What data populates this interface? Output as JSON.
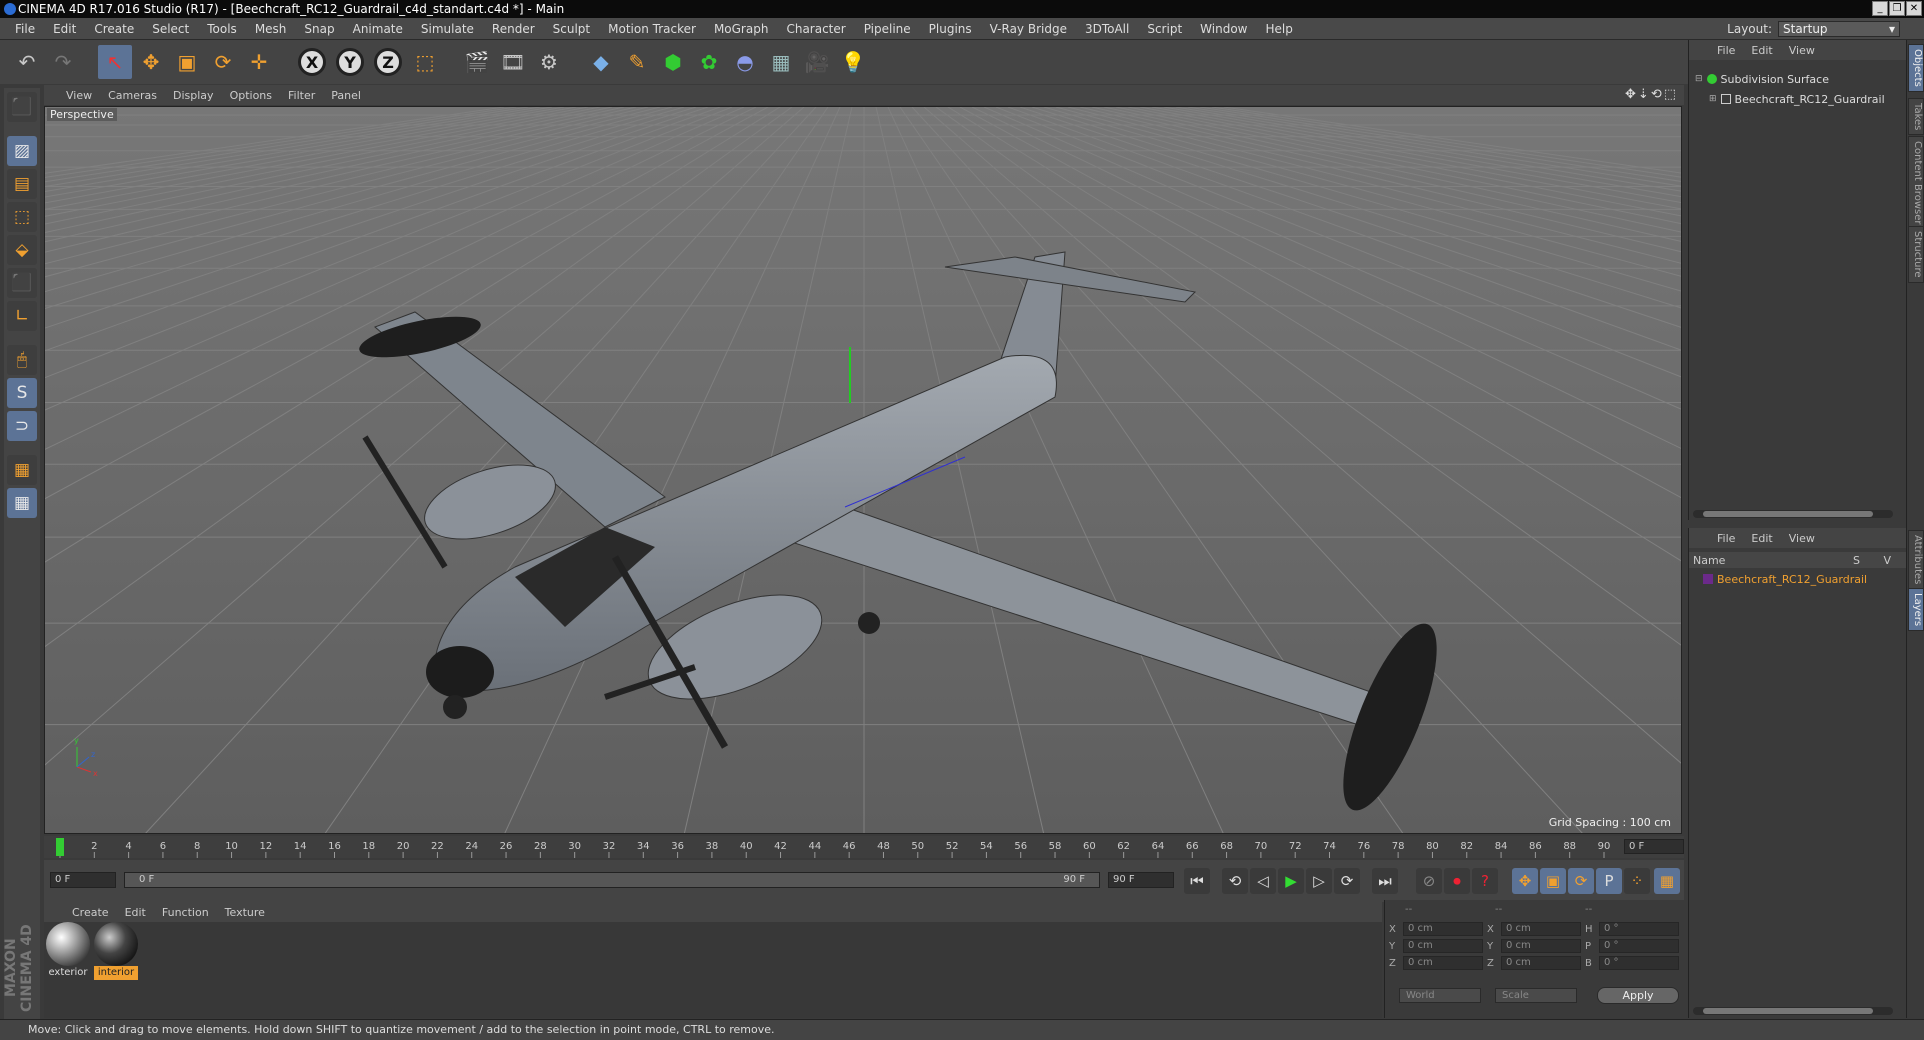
{
  "window": {
    "title": "CINEMA 4D R17.016 Studio (R17) - [Beechcraft_RC12_Guardrail_c4d_standart.c4d *] - Main",
    "buttons": [
      "_",
      "❐",
      "✕"
    ]
  },
  "menu": [
    "File",
    "Edit",
    "Create",
    "Select",
    "Tools",
    "Mesh",
    "Snap",
    "Animate",
    "Simulate",
    "Render",
    "Sculpt",
    "Motion Tracker",
    "MoGraph",
    "Character",
    "Pipeline",
    "Plugins",
    "V-Ray Bridge",
    "3DToAll",
    "Script",
    "Window",
    "Help"
  ],
  "layout": {
    "label": "Layout:",
    "value": "Startup"
  },
  "toolbar": {
    "undo": "↶",
    "redo": "↷",
    "select": "↖",
    "move": "✥",
    "scale": "▣",
    "rotate": "⟳",
    "last": "✛",
    "x": "X",
    "y": "Y",
    "z": "Z",
    "coord": "⬚",
    "render_view": "🎬",
    "render_pv": "🎞",
    "render_settings": "⚙",
    "cube": "◆",
    "pen": "✎",
    "nurbs": "⬢",
    "array": "✿",
    "deformer": "◓",
    "floor": "▦",
    "camera": "🎥",
    "light": "💡"
  },
  "lefttools": [
    "⬛",
    "▨",
    "▤",
    "⬚",
    "⬙",
    "⬛",
    "∟",
    "🖱",
    "S",
    "⊃",
    "▦",
    "▦"
  ],
  "viewport": {
    "menu": [
      "View",
      "Cameras",
      "Display",
      "Options",
      "Filter",
      "Panel"
    ],
    "nav_icons": "✥⇣⟲⬚",
    "label": "Perspective",
    "grid_spacing": "Grid Spacing : 100 cm",
    "axis": {
      "x": "x",
      "y": "y",
      "z": "z"
    }
  },
  "timeline": {
    "ticks": [
      0,
      2,
      4,
      6,
      8,
      10,
      12,
      14,
      16,
      18,
      20,
      22,
      24,
      26,
      28,
      30,
      32,
      34,
      36,
      38,
      40,
      42,
      44,
      46,
      48,
      50,
      52,
      54,
      56,
      58,
      60,
      62,
      64,
      66,
      68,
      70,
      72,
      74,
      76,
      78,
      80,
      82,
      84,
      86,
      88,
      90
    ],
    "current": "0 F"
  },
  "playback": {
    "start": "0 F",
    "slider_left": "0 F",
    "slider_right": "90 F",
    "end": "90 F",
    "buttons": [
      "⏮",
      "⟲",
      "◁",
      "▶",
      "▷",
      "⟳",
      "⏭",
      "⊘",
      "⏺",
      "?",
      "✥",
      "▣",
      "⟳",
      "P",
      "⁘",
      "▦"
    ]
  },
  "materials": {
    "menu": [
      "Create",
      "Edit",
      "Function",
      "Texture"
    ],
    "items": [
      {
        "name": "exterior",
        "selected": false
      },
      {
        "name": "interior",
        "selected": true
      }
    ]
  },
  "coordinates": {
    "headers": [
      "--",
      "--",
      "--"
    ],
    "rows": [
      {
        "a": "X",
        "av": "0 cm",
        "b": "X",
        "bv": "0 cm",
        "c": "H",
        "cv": "0 °"
      },
      {
        "a": "Y",
        "av": "0 cm",
        "b": "Y",
        "bv": "0 cm",
        "c": "P",
        "cv": "0 °"
      },
      {
        "a": "Z",
        "av": "0 cm",
        "b": "Z",
        "bv": "0 cm",
        "c": "B",
        "cv": "0 °"
      }
    ],
    "world": "World",
    "scale": "Scale",
    "apply": "Apply"
  },
  "objects": {
    "menu": [
      "File",
      "Edit",
      "View"
    ],
    "items": [
      {
        "name": "Subdivision Surface",
        "color": "#3c3"
      },
      {
        "name": "Beechcraft_RC12_Guardrail",
        "color": "#ccc"
      }
    ]
  },
  "layers": {
    "menu": [
      "File",
      "Edit",
      "View"
    ],
    "header_name": "Name",
    "header_sv": "S V",
    "items": [
      {
        "name": "Beechcraft_RC12_Guardrail",
        "color": "#f0a030"
      }
    ]
  },
  "vtabs": {
    "top": [
      "Objects",
      "Takes",
      "Content Browser",
      "Structure"
    ],
    "bottom": [
      "Attributes",
      "Layers"
    ]
  },
  "status": "Move: Click and drag to move elements. Hold down SHIFT to quantize movement / add to the selection in point mode, CTRL to remove.",
  "brand": "MAXON CINEMA 4D"
}
